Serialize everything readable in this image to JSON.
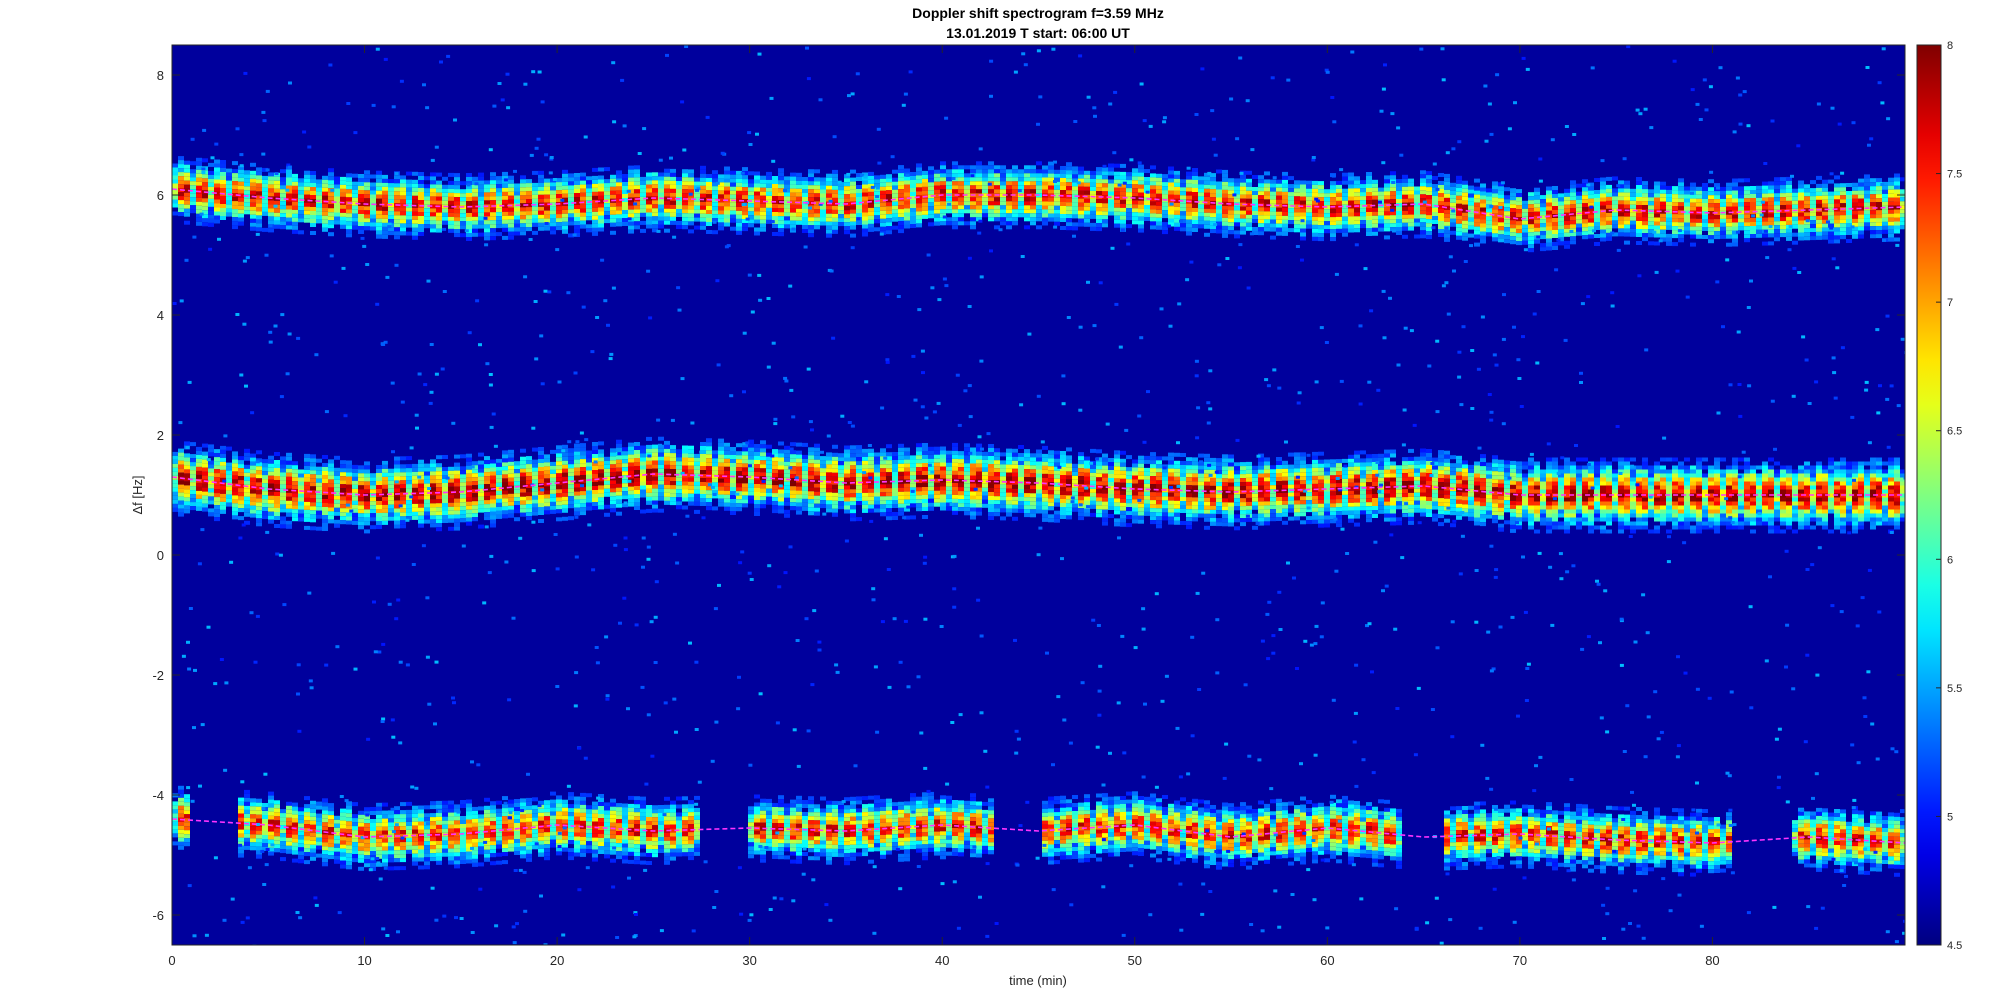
{
  "chart_data": {
    "type": "heatmap",
    "title": "Doppler shift spectrogram f=3.59 MHz",
    "subtitle": "13.01.2019   T start: 06:00 UT",
    "xlabel": "time (min)",
    "ylabel": "Δf [Hz]",
    "xlim": [
      0,
      90
    ],
    "ylim": [
      -6.5,
      8.5
    ],
    "xticks": [
      "0",
      "10",
      "20",
      "30",
      "40",
      "50",
      "60",
      "70",
      "80"
    ],
    "yticks": [
      "-6",
      "-4",
      "-2",
      "0",
      "2",
      "4",
      "6",
      "8"
    ],
    "colorbar": {
      "ticks": [
        "4.5",
        "5",
        "5.5",
        "6",
        "6.5",
        "7",
        "7.5",
        "8"
      ],
      "range": [
        4.5,
        8
      ],
      "colormap": "jet",
      "colors": [
        "#00008f",
        "#0000ff",
        "#00ffff",
        "#ffff00",
        "#ff0000",
        "#800000"
      ]
    },
    "background_level": 4.6,
    "series": [
      {
        "band_halfwidth": 0.45,
        "peak_level": 7.6,
        "x": [
          0,
          5,
          10,
          15,
          20,
          25,
          30,
          35,
          40,
          45,
          50,
          55,
          60,
          65,
          70,
          75,
          80,
          85,
          90
        ],
        "values": [
          6.1,
          5.95,
          5.85,
          5.8,
          5.85,
          5.95,
          5.9,
          5.85,
          6.0,
          6.0,
          5.95,
          5.85,
          5.8,
          5.85,
          5.6,
          5.75,
          5.7,
          5.75,
          5.8
        ]
      },
      {
        "band_halfwidth": 0.5,
        "peak_level": 7.8,
        "x": [
          0,
          5,
          10,
          15,
          20,
          25,
          30,
          35,
          40,
          45,
          50,
          55,
          60,
          65,
          70,
          75,
          80,
          85,
          90
        ],
        "values": [
          1.3,
          1.1,
          1.0,
          1.05,
          1.2,
          1.35,
          1.3,
          1.2,
          1.25,
          1.2,
          1.1,
          1.05,
          1.1,
          1.15,
          1.0,
          1.0,
          1.0,
          1.0,
          1.0
        ]
      },
      {
        "band_halfwidth": 0.45,
        "peak_level": 7.5,
        "x": [
          0,
          5,
          10,
          15,
          20,
          25,
          30,
          35,
          40,
          45,
          50,
          55,
          60,
          65,
          70,
          75,
          80,
          85,
          90
        ],
        "values": [
          -4.4,
          -4.5,
          -4.7,
          -4.65,
          -4.5,
          -4.6,
          -4.55,
          -4.6,
          -4.5,
          -4.6,
          -4.5,
          -4.7,
          -4.55,
          -4.7,
          -4.65,
          -4.75,
          -4.8,
          -4.7,
          -4.8
        ],
        "gaps": [
          [
            0.8,
            3.3
          ],
          [
            27.5,
            30.0
          ],
          [
            42.8,
            45.2
          ],
          [
            63.8,
            66.2
          ],
          [
            81.0,
            84.0
          ]
        ]
      }
    ],
    "trace_color": "#ff33ff"
  }
}
